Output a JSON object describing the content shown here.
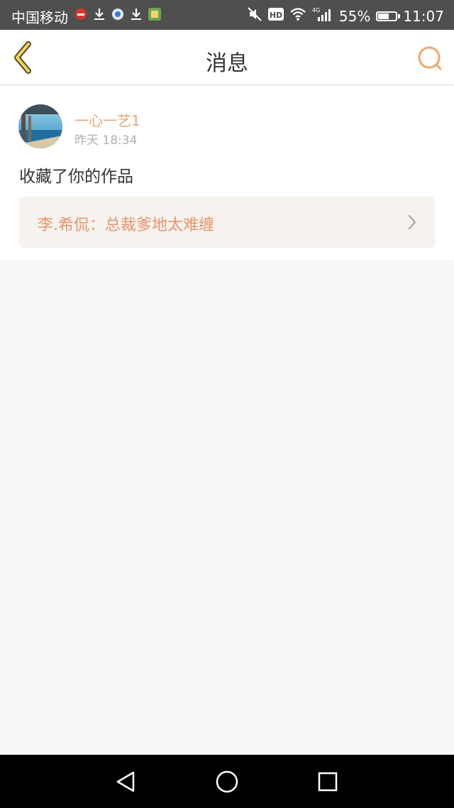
{
  "status_bar": {
    "carrier": "中国移动",
    "battery_text": "55%",
    "battery_level": 0.55,
    "time": "11:07",
    "network_label": "4G",
    "hd_label": "HD",
    "icons": [
      "notification-red-icon",
      "download-icon",
      "browser-icon",
      "download-icon",
      "app-green-icon",
      "mute-icon",
      "hd-icon",
      "wifi-icon",
      "signal-icon",
      "battery-icon"
    ]
  },
  "header": {
    "title": "消息",
    "back_icon": "chevron-left-icon",
    "search_icon": "search-icon"
  },
  "message": {
    "username": "一心一艺1",
    "time": "昨天 18:34",
    "text": "收藏了你的作品",
    "work_title": "李.希侃：总裁爹地太难缠"
  },
  "colors": {
    "accent": "#e9a777",
    "link_text": "#e9956a",
    "link_bg": "#f6f2ed",
    "status_bar": "#4f4f4f",
    "page_bg": "#f8f6f6"
  },
  "navbar": {
    "buttons": [
      "back-triangle-icon",
      "home-circle-icon",
      "recents-square-icon"
    ]
  }
}
